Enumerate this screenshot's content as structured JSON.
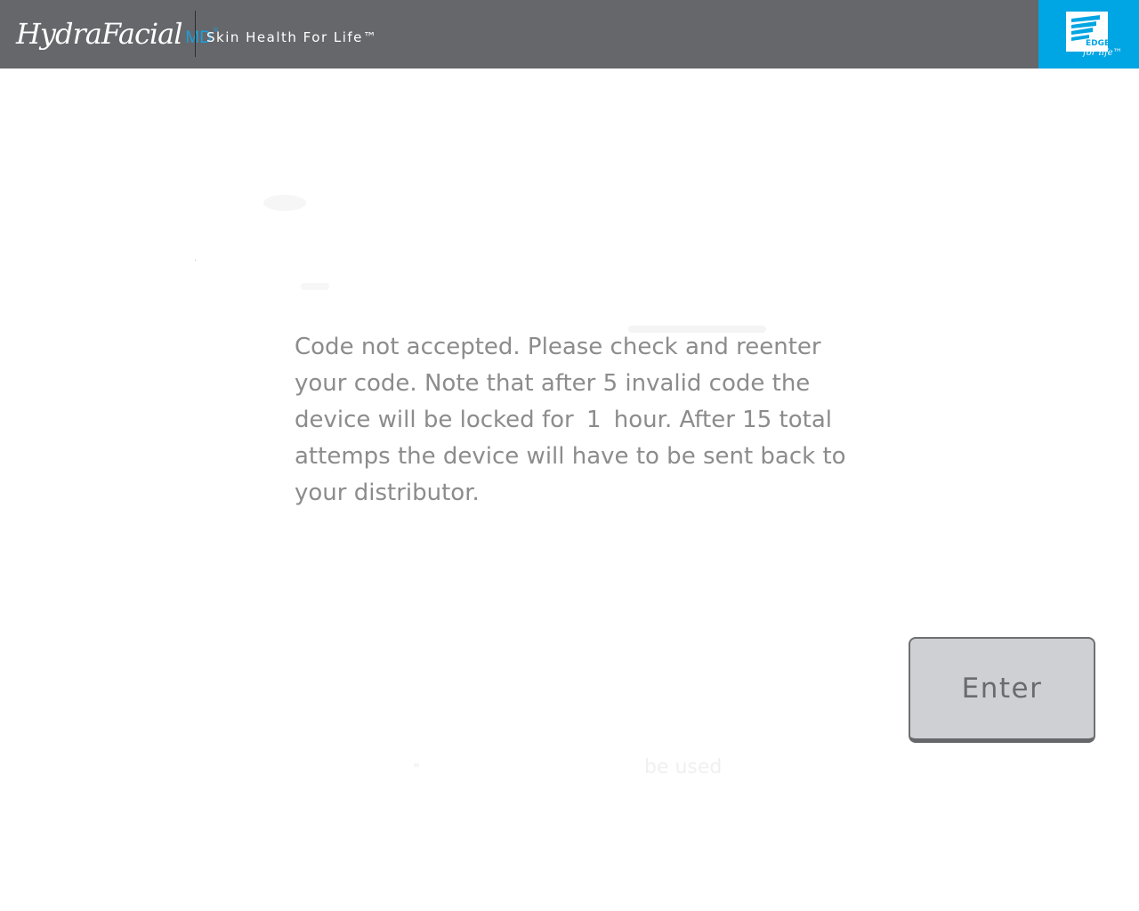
{
  "header": {
    "brand_script": "HydraFacial",
    "brand_md": "MD",
    "brand_reg": "®",
    "tagline": "Skin Health For Life™",
    "edge_logo_label": "EDGE",
    "edge_logo_sub": "for life™",
    "colors": {
      "header_bg": "#66676b",
      "brand_accent": "#1aa0dc",
      "edge_panel_bg": "#00a5e3"
    }
  },
  "message": {
    "line1": "Code not accepted. Please check and reenter your code. Note that after 5 invalid code the device will be locked for ",
    "lock_hours": "1",
    "line2": " hour. After 15 total attemps the device will have to be sent back to your distributor."
  },
  "enter_button": {
    "label": "Enter"
  },
  "ghost": {
    "bottom_text": "be used"
  }
}
